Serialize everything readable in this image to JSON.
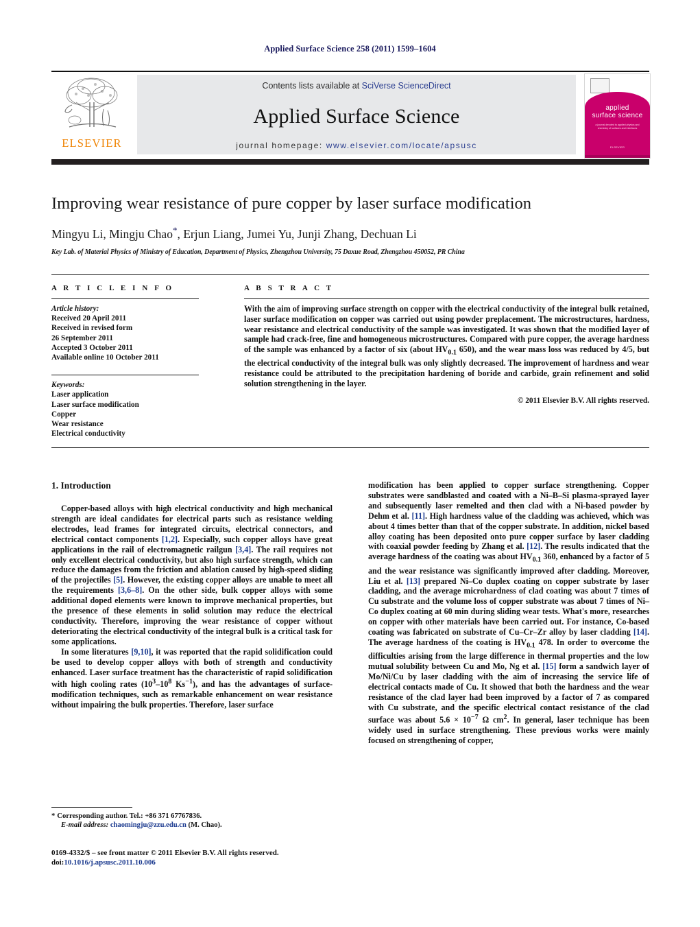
{
  "running_head": "Applied Surface Science 258 (2011) 1599–1604",
  "masthead": {
    "contents_prefix": "Contents lists available at ",
    "contents_link": "SciVerse ScienceDirect",
    "journal_title": "Applied Surface Science",
    "homepage_prefix": "journal homepage: ",
    "homepage_url": "www.elsevier.com/locate/apsusc",
    "publisher_wordmark": "ELSEVIER"
  },
  "cover": {
    "title_line1": "applied",
    "title_line2": "surface science",
    "subtitle": "a journal devoted to applied physics and chemistry of surfaces and interfaces",
    "footer": "ELSEVIER"
  },
  "article": {
    "title": "Improving wear resistance of pure copper by laser surface modification",
    "authors": "Mingyu Li, Mingju Chao",
    "authors_tail": ", Erjun Liang, Jumei Yu, Junji Zhang, Dechuan Li",
    "corresponding_marker": "*",
    "affiliation": "Key Lab. of Material Physics of Ministry of Education, Department of Physics, Zhengzhou University, 75 Daxue Road, Zhengzhou 450052, PR China"
  },
  "article_info": {
    "heading": "A R T I C L E   I N F O",
    "history_label": "Article history:",
    "history": [
      "Received 20 April 2011",
      "Received in revised form",
      "26 September 2011",
      "Accepted 3 October 2011",
      "Available online 10 October 2011"
    ],
    "keywords_label": "Keywords:",
    "keywords": [
      "Laser application",
      "Laser surface modification",
      "Copper",
      "Wear resistance",
      "Electrical conductivity"
    ]
  },
  "abstract": {
    "heading": "A B S T R A C T",
    "text_part1": "With the aim of improving surface strength on copper with the electrical conductivity of the integral bulk retained, laser surface modification on copper was carried out using powder preplacement. The microstructures, hardness, wear resistance and electrical conductivity of the sample was investigated. It was shown that the modified layer of sample had crack-free, fine and homogeneous microstructures. Compared with pure copper, the average hardness of the sample was enhanced by a factor of six (about HV",
    "sub1": "0.1",
    "text_part2": " 650), and the wear mass loss was reduced by 4/5, but the electrical conductivity of the integral bulk was only slightly decreased. The improvement of hardness and wear resistance could be attributed to the precipitation hardening of boride and carbide, grain refinement and solid solution strengthening in the layer.",
    "copyright": "© 2011 Elsevier B.V. All rights reserved."
  },
  "introduction": {
    "heading": "1. Introduction",
    "left_p1_a": "Copper-based alloys with high electrical conductivity and high mechanical strength are ideal candidates for electrical parts such as resistance welding electrodes, lead frames for integrated circuits, electrical connectors, and electrical contact components ",
    "left_p1_ref1": "[1,2]",
    "left_p1_b": ". Especially, such copper alloys have great applications in the rail of electromagnetic railgun ",
    "left_p1_ref2": "[3,4]",
    "left_p1_c": ". The rail requires not only excellent electrical conductivity, but also high surface strength, which can reduce the damages from the friction and ablation caused by high-speed sliding of the projectiles ",
    "left_p1_ref3": "[5]",
    "left_p1_d": ". However, the existing copper alloys are unable to meet all the requirements ",
    "left_p1_ref4": "[3,6–8]",
    "left_p1_e": ". On the other side, bulk copper alloys with some additional doped elements were known to improve mechanical properties, but the presence of these elements in solid solution may reduce the electrical conductivity. Therefore, improving the wear resistance of copper without deteriorating the electrical conductivity of the integral bulk is a critical task for some applications.",
    "left_p2_a": "In some literatures ",
    "left_p2_ref1": "[9,10]",
    "left_p2_b": ", it was reported that the rapid solidification could be used to develop copper alloys with both of strength and conductivity enhanced. Laser surface treatment has the characteristic of rapid solidification with high cooling rates (10",
    "left_p2_sup1": "3",
    "left_p2_c": "–10",
    "left_p2_sup2": "8",
    "left_p2_d": " Ks",
    "left_p2_sup3": "−1",
    "left_p2_e": "), and has the advantages of surface-modification techniques, such as remarkable enhancement on wear resistance without impairing the bulk properties. Therefore, laser surface",
    "right_p1_a": "modification has been applied to copper surface strengthening. Copper substrates were sandblasted and coated with a Ni–B–Si plasma-sprayed layer and subsequently laser remelted and then clad with a Ni-based powder by Dehm et al. ",
    "right_p1_ref1": "[11]",
    "right_p1_b": ". High hardness value of the cladding was achieved, which was about 4 times better than that of the copper substrate. In addition, nickel based alloy coating has been deposited onto pure copper surface by laser cladding with coaxial powder feeding by Zhang et al. ",
    "right_p1_ref2": "[12]",
    "right_p1_c": ". The results indicated that the average hardness of the coating was about HV",
    "right_p1_sub1": "0.1",
    "right_p1_d": " 360, enhanced by a factor of 5 and the wear resistance was significantly improved after cladding. Moreover, Liu et al. ",
    "right_p1_ref3": "[13]",
    "right_p1_e": " prepared Ni–Co duplex coating on copper substrate by laser cladding, and the average microhardness of clad coating was about 7 times of Cu substrate and the volume loss of copper substrate was about 7 times of Ni–Co duplex coating at 60 min during sliding wear tests. What's more, researches on copper with other materials have been carried out. For instance, Co-based coating was fabricated on substrate of Cu–Cr–Zr alloy by laser cladding ",
    "right_p1_ref4": "[14]",
    "right_p1_f": ". The average hardness of the coating is HV",
    "right_p1_sub2": "0.1",
    "right_p1_g": " 478. In order to overcome the difficulties arising from the large difference in thermal properties and the low mutual solubility between Cu and Mo, Ng et al. ",
    "right_p1_ref5": "[15]",
    "right_p1_h": " form a sandwich layer of Mo/Ni/Cu by laser cladding with the aim of increasing the service life of electrical contacts made of Cu. It showed that both the hardness and the wear resistance of the clad layer had been improved by a factor of 7 as compared with Cu substrate, and the specific electrical contact resistance of the clad surface was about 5.6 × 10",
    "right_p1_sup1": "−7",
    "right_p1_i": " Ω cm",
    "right_p1_sup2": "2",
    "right_p1_j": ". In general, laser technique has been widely used in surface strengthening. These previous works were mainly focused on strengthening of copper,"
  },
  "footnotes": {
    "corresponding_marker": "*",
    "corresponding": "Corresponding author. Tel.: +86 371 67767836.",
    "email_label": "E-mail address:",
    "email": "chaomingju@zzu.edu.cn",
    "email_suffix": " (M. Chao)."
  },
  "footer": {
    "issn_line": "0169-4332/$ – see front matter © 2011 Elsevier B.V. All rights reserved.",
    "doi_prefix": "doi:",
    "doi": "10.1016/j.apsusc.2011.10.006"
  },
  "colors": {
    "link_blue": "#2a3d8f",
    "ref_blue": "#1b3a8f",
    "elsevier_orange": "#ef8200",
    "cover_pink": "#c9006b",
    "band_grey": "#e7e8ea"
  }
}
